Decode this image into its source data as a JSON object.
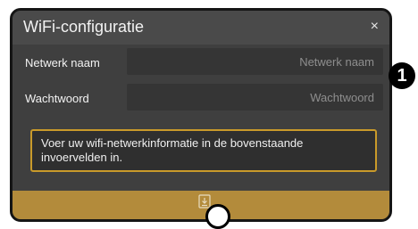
{
  "dialog": {
    "title": "WiFi-configuratie",
    "close_glyph": "×",
    "network": {
      "label": "Netwerk naam",
      "placeholder": "Netwerk naam",
      "value": ""
    },
    "password": {
      "label": "Wachtwoord",
      "placeholder": "Wachtwoord",
      "value": ""
    },
    "info_text": "Voer uw wifi-netwerkinformatie in de bovenstaande invoervelden in.",
    "footer": {
      "icon": "save-icon"
    }
  },
  "callouts": {
    "one": "1"
  },
  "colors": {
    "dialog_bg": "#3f3f3f",
    "titlebar_bg": "#4a4a4a",
    "input_bg": "#353535",
    "accent_border": "#c99a2a",
    "footer_bg": "#b38b3b"
  }
}
